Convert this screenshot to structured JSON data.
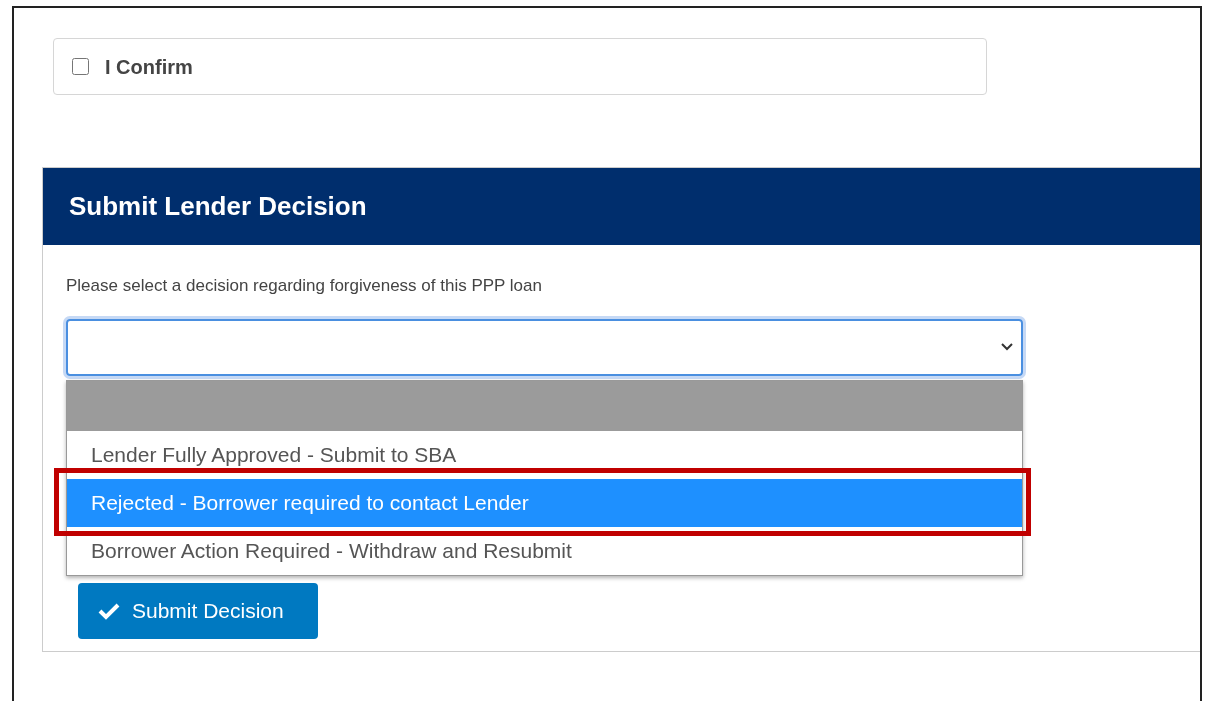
{
  "confirm": {
    "label": "I Confirm",
    "checked": false
  },
  "panel": {
    "title": "Submit Lender Decision",
    "prompt": "Please select a decision regarding forgiveness of this PPP loan"
  },
  "select": {
    "open": true,
    "blank_option_selected": true,
    "options": [
      {
        "label": "Lender Fully Approved - Submit to SBA",
        "highlighted": false,
        "annotated": false
      },
      {
        "label": "Rejected - Borrower required to contact Lender",
        "highlighted": true,
        "annotated": true
      },
      {
        "label": "Borrower Action Required - Withdraw and Resubmit",
        "highlighted": false,
        "annotated": false
      }
    ]
  },
  "submit_button": {
    "label": "Submit Decision"
  }
}
